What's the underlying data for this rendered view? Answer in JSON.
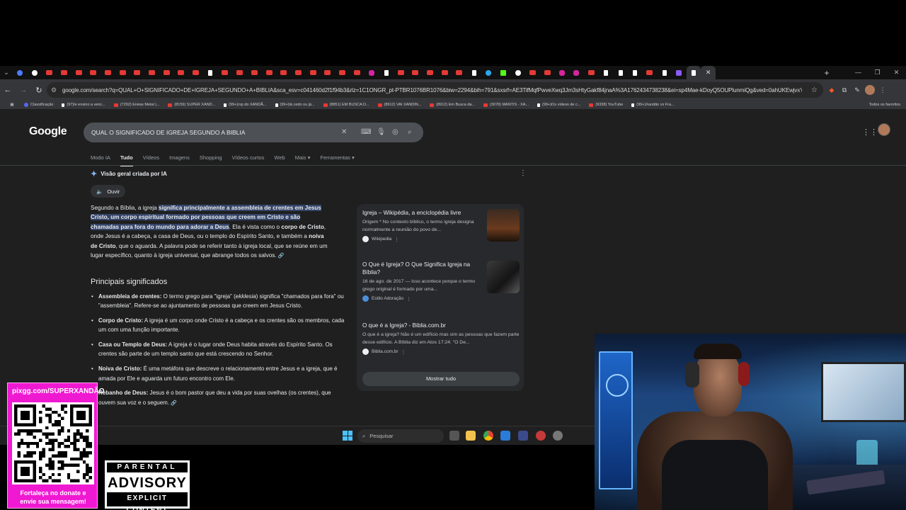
{
  "browser": {
    "url": "google.com/search?q=QUAL+O+SIGNIFICADO+DE+IGREJA+SEGUNDO+A+BIBLIA&sca_esv=c041460d2f1f94b3&rlz=1C1ONGR_pt-PTBR1076BR1076&biw=2294&bih=791&sxsrf=AE3TifMqfPwveXwq3Jm3sHtyGakf84jnaA%3A1762434738238&ei=sp4Mae-kDoyQ5OUPlunmiQg&ved=0ahUKEwjvxYyEzd2...",
    "tab_favicons": [
      "bl",
      "gg",
      "yt",
      "yt",
      "yt",
      "yt",
      "yt",
      "yt",
      "yt",
      "yt",
      "yt",
      "yt",
      "yt",
      "tt",
      "yt",
      "yt",
      "yt",
      "yt",
      "yt",
      "yt",
      "yt",
      "yt",
      "yt",
      "yt",
      "ig",
      "tt",
      "yt",
      "yt",
      "yt",
      "yt",
      "yt",
      "tt",
      "tg",
      "kk",
      "gg",
      "yt",
      "yt",
      "ig",
      "ig",
      "yt",
      "tt",
      "tt",
      "tt",
      "yt",
      "tt",
      "tw",
      "tt"
    ],
    "bookmarks": [
      {
        "label": "Classificação",
        "icon": "dc"
      },
      {
        "label": "(97)Ie ensino a venc...",
        "icon": "tt"
      },
      {
        "label": "(7292) Enéas Metal |...",
        "icon": "yt"
      },
      {
        "label": "(8159) SUPER XAND...",
        "icon": "yt"
      },
      {
        "label": "(99+)rsp do XANDÃ...",
        "icon": "tt"
      },
      {
        "label": "(99+)tá cedo ou já...",
        "icon": "tt"
      },
      {
        "label": "(8851) EM BUSCA D...",
        "icon": "yt"
      },
      {
        "label": "(8912) VAI XANDIN...",
        "icon": "yt"
      },
      {
        "label": "(8912) Em Busca da...",
        "icon": "yt"
      },
      {
        "label": "(3078) MANTIS - XA...",
        "icon": "yt"
      },
      {
        "label": "(99+)Os vídeos de c...",
        "icon": "tt"
      },
      {
        "label": "(9338) YouTube",
        "icon": "yt"
      },
      {
        "label": "(99+)Xandão vs Fra...",
        "icon": "tt"
      }
    ],
    "all_bookmarks": "Todos os favoritos"
  },
  "google": {
    "logo": "Google",
    "query": "QUAL O SIGNIFICADO DE IGREJA SEGUNDO A BIBLIA",
    "tabs": [
      "Modo IA",
      "Tudo",
      "Vídeos",
      "Imagens",
      "Shopping",
      "Vídeos curtos",
      "Web",
      "Mais ▾",
      "Ferramentas ▾"
    ],
    "active_tab": "Tudo",
    "ai_header": "Visão geral criada por IA",
    "listen": "Ouvir",
    "ai_text": {
      "p1_a": "Segundo a Bíblia, a igreja ",
      "p1_hl": "significa principalmente a assembleia de crentes em Jesus Cristo, um corpo espiritual formado por pessoas que creem em Cristo e são chamadas para fora do mundo para adorar a Deus",
      "p1_b": ". Ela é vista como o ",
      "p1_b1": "corpo de Cristo",
      "p1_c": ", onde Jesus é a cabeça, a casa de Deus, ou o templo do Espírito Santo, e também a ",
      "p1_b2": "noiva de Cristo",
      "p1_d": ", que o aguarda. A palavra pode se referir tanto à igreja local, que se reúne em um lugar específico, quanto à igreja universal, que abrange todos os salvos."
    },
    "principais_title": "Principais significados",
    "bullets": [
      {
        "title": "Assembleia de crentes:",
        "pre": " O termo grego para \"igreja\" (",
        "em": "ekklesia",
        "text": ") significa \"chamados para fora\" ou \"assembleia\". Refere-se ao ajuntamento de pessoas que creem em Jesus Cristo."
      },
      {
        "title": "Corpo de Cristo:",
        "pre": "",
        "em": "",
        "text": " A igreja é um corpo onde Cristo é a cabeça e os crentes são os membros, cada um com uma função importante."
      },
      {
        "title": "Casa ou Templo de Deus:",
        "pre": "",
        "em": "",
        "text": " A igreja é o lugar onde Deus habita através do Espírito Santo. Os crentes são parte de um templo santo que está crescendo no Senhor."
      },
      {
        "title": "Noiva de Cristo:",
        "pre": "",
        "em": "",
        "text": " É uma metáfora que descreve o relacionamento entre Jesus e a igreja, que é amada por Ele e aguarda um futuro encontro com Ele."
      },
      {
        "title": "Rebanho de Deus:",
        "pre": "",
        "em": "",
        "text": " Jesus é o bom pastor que deu a vida por suas ovelhas (os crentes), que ouvem sua voz e o seguem."
      }
    ],
    "sources": [
      {
        "title": "Igreja – Wikipédia, a enciclopédia livre",
        "snippet": "Origem * No contexto bíblico, o termo igreja designa normalmente a reunião do povo de...",
        "site": "Wikipedia"
      },
      {
        "title": "O Que é Igreja? O Que Significa Igreja na Bíblia?",
        "snippet": "16 de ago. de 2017 — Isso acontece porque o termo grego original é formado por uma...",
        "site": "Estilo Adoração"
      },
      {
        "title": "O que é a Igreja? - Biblia.com.br",
        "snippet": "O que é a igreja? Não é um edifício mas sim as pessoas que fazem parte desse edifício. A Bíblia diz em Atos 17:24: \"O De...",
        "site": "Biblia.com.br"
      }
    ],
    "show_all": "Mostrar tudo"
  },
  "taskbar": {
    "search_placeholder": "Pesquisar"
  },
  "overlay": {
    "qr_url": "pixgg.com/SUPERXANDÃO",
    "qr_caption_1": "Fortaleça no donate e",
    "qr_caption_2": "envie sua mensagem!",
    "advisory_top": "PARENTAL",
    "advisory_mid": "ADVISORY",
    "advisory_bot": "EXPLICIT CONTENT"
  },
  "colors": {
    "accent": "#8ab4f8",
    "highlight": "#344468",
    "qr_card": "#f019d2"
  }
}
